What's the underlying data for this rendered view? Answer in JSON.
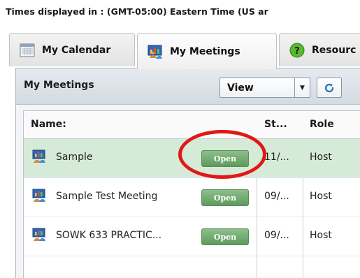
{
  "timezone_notice": "Times displayed in : (GMT-05:00) Eastern Time (US ar",
  "tabs": [
    {
      "label": "My Calendar",
      "icon": "calendar-icon"
    },
    {
      "label": "My Meetings",
      "icon": "meetings-icon"
    },
    {
      "label": "Resourc",
      "icon": "help-icon"
    }
  ],
  "panel": {
    "title": "My Meetings",
    "view_select": "View",
    "view_select_arrow": "▼",
    "refresh_icon": "refresh-icon"
  },
  "table": {
    "columns": [
      "Name:",
      "St...",
      "Role"
    ],
    "rows": [
      {
        "name": "Sample",
        "start": "11/...",
        "role": "Host",
        "action": "Open",
        "selected": true
      },
      {
        "name": "Sample Test Meeting",
        "start": "09/...",
        "role": "Host",
        "action": "Open",
        "selected": false
      },
      {
        "name": "SOWK 633 PRACTIC...",
        "start": "09/...",
        "role": "Host",
        "action": "Open",
        "selected": false
      }
    ]
  },
  "colors": {
    "open_button": "#6fa96c",
    "selected_row": "#d6ebd7",
    "highlight_ring": "#e01818"
  }
}
